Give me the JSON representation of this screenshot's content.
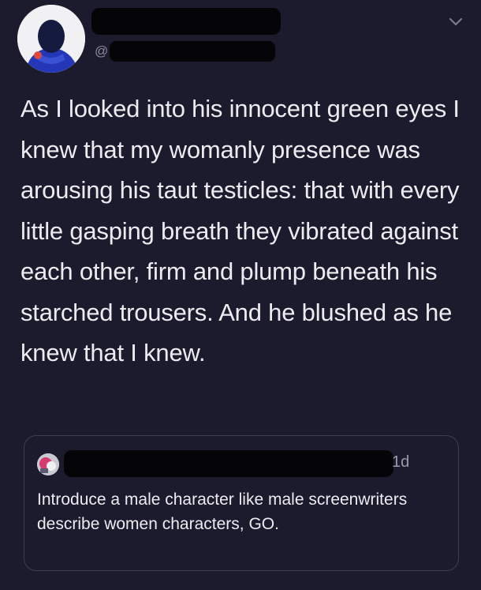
{
  "tweet": {
    "author": {
      "handle_prefix": "@",
      "avatar_icon": "profile-avatar",
      "name_redacted": true,
      "handle_redacted": true
    },
    "menu_icon": "chevron-down-icon",
    "text": "As I looked into his innocent green eyes I knew that my womanly presence was arousing his taut testicles: that with every little gasping breath they vibrated against each other, firm and plump beneath his starched trousers. And he blushed as he knew that I knew."
  },
  "quoted_tweet": {
    "avatar_icon": "profile-avatar",
    "name_redacted": true,
    "timestamp": "1d",
    "text": "Introduce a male character like male screenwriters describe women characters, GO."
  },
  "colors": {
    "background": "#1c1b2e",
    "text": "#ececf0",
    "secondary_text": "#8b8c99",
    "card_border": "#3e3d52",
    "redaction": "#050507"
  }
}
